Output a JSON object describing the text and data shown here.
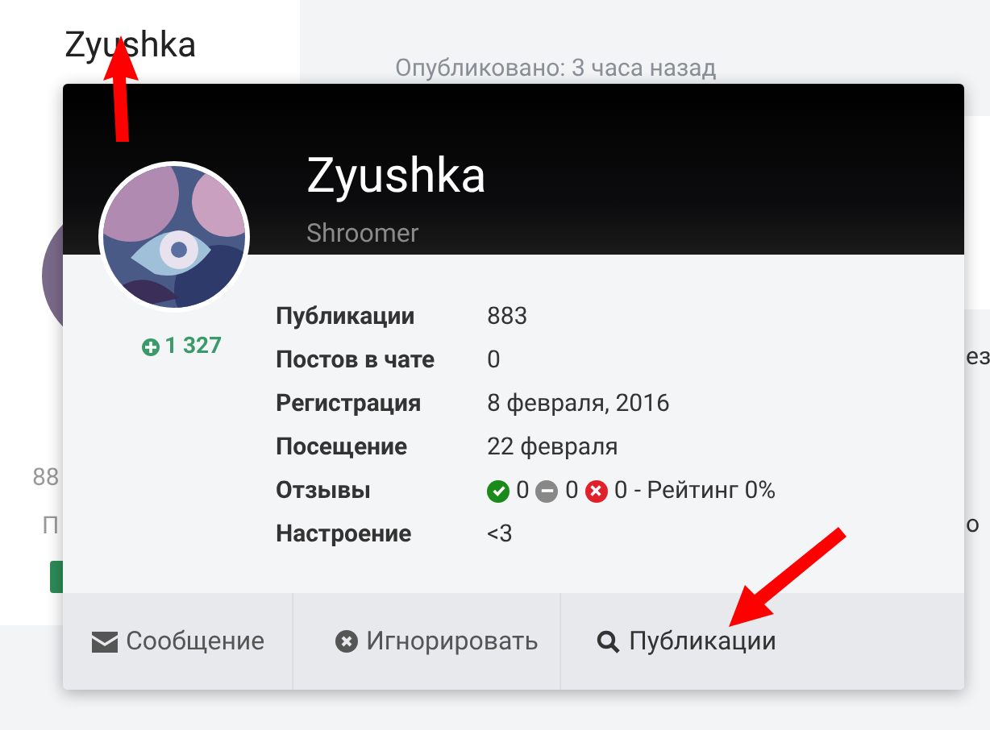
{
  "background": {
    "author_name": "Zyushka",
    "posted": "Опубликовано: 3 часа назад",
    "side_fragments": [
      "88",
      "П"
    ],
    "right_fragments": [
      "ез",
      "о"
    ]
  },
  "popup": {
    "name": "Zyushka",
    "group": "Shroomer",
    "reputation": "1 327",
    "stats": [
      {
        "label": "Публикации",
        "value": "883"
      },
      {
        "label": "Постов в чате",
        "value": "0"
      },
      {
        "label": "Регистрация",
        "value": "8 февраля, 2016"
      },
      {
        "label": "Посещение",
        "value": "22 февраля"
      },
      {
        "label": "Отзывы",
        "kind": "feedback",
        "counts": [
          {
            "kind": "positive",
            "value": "0"
          },
          {
            "kind": "neutral",
            "value": "0"
          },
          {
            "kind": "negative",
            "value": "0"
          }
        ],
        "value": "- Рейтинг 0%"
      },
      {
        "label": "Настроение",
        "value": "<3"
      }
    ],
    "actions": [
      {
        "kind": "message",
        "label": "Сообщение"
      },
      {
        "kind": "ignore",
        "label": "Игнорировать"
      },
      {
        "kind": "search",
        "label": "Публикации"
      }
    ]
  }
}
